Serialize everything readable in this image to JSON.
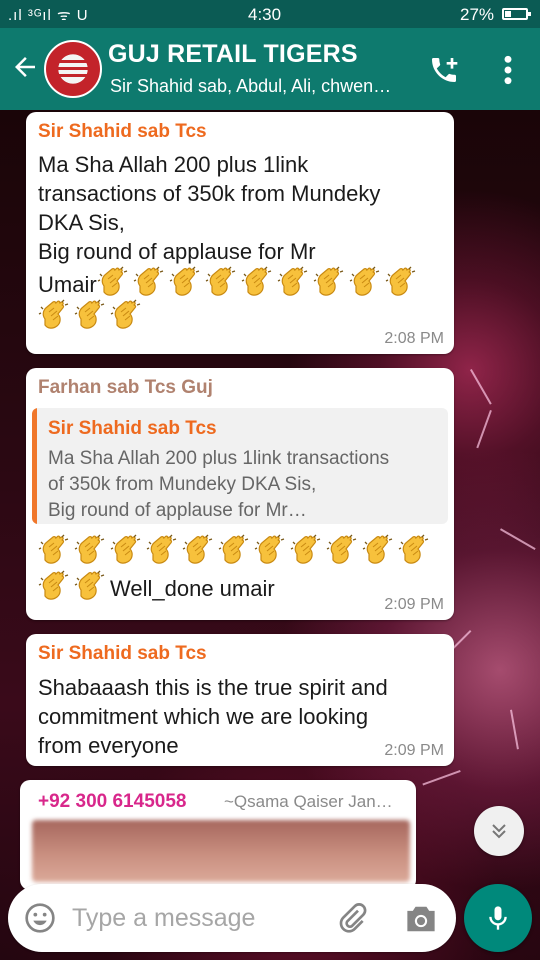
{
  "status_bar": {
    "signal": ".ıl ³ᴳıl ᯤ U",
    "time": "4:30",
    "battery_text": "27%",
    "battery_level": 0.27
  },
  "header": {
    "title": "GUJ RETAIL TIGERS",
    "subtitle": "Sir Shahid sab, Abdul, Ali, chwen…"
  },
  "messages": [
    {
      "sender": "Sir Shahid sab Tcs",
      "sender_color": "#ee6a1f",
      "text_lines": [
        "Ma Sha Allah 200 plus 1link",
        "transactions of 350k from Mundeky",
        "DKA Sis,",
        "Big round of applause for Mr",
        "Umair"
      ],
      "claps_inline": 9,
      "claps_next_line": 3,
      "time": "2:08 PM"
    },
    {
      "sender": "Farhan sab Tcs Guj",
      "sender_color": "#b0826f",
      "quote": {
        "sender": "Sir Shahid sab Tcs",
        "text_lines": [
          "Ma Sha Allah 200 plus 1link transactions",
          "of 350k from Mundeky DKA Sis,",
          "Big round of applause for Mr…"
        ]
      },
      "claps_line1": 11,
      "claps_line2": 2,
      "text": "Well_done umair",
      "time": "2:09 PM"
    },
    {
      "sender": "Sir Shahid sab Tcs",
      "sender_color": "#ee6a1f",
      "text_lines": [
        "Shabaaash this is the true spirit and",
        "commitment which we are looking",
        "from everyone"
      ],
      "time": "2:09 PM"
    },
    {
      "sender": "+92 300 6145058",
      "sender_color": "#d8278b",
      "push_name": "~Qsama Qaiser Jan…"
    }
  ],
  "input": {
    "placeholder": "Type a message"
  },
  "icons": {
    "back": "arrow-back-icon",
    "call": "add-call-icon",
    "menu": "more-vertical-icon",
    "emoji": "emoji-icon",
    "attach": "paperclip-icon",
    "camera": "camera-icon",
    "mic": "microphone-icon",
    "scroll": "double-chevron-down-icon",
    "clap": "clapping-hands-icon"
  },
  "colors": {
    "statusbar": "#0b5b54",
    "appbar": "#0e7a6e",
    "mic": "#00897b",
    "quote_bar": "#f0772b"
  }
}
